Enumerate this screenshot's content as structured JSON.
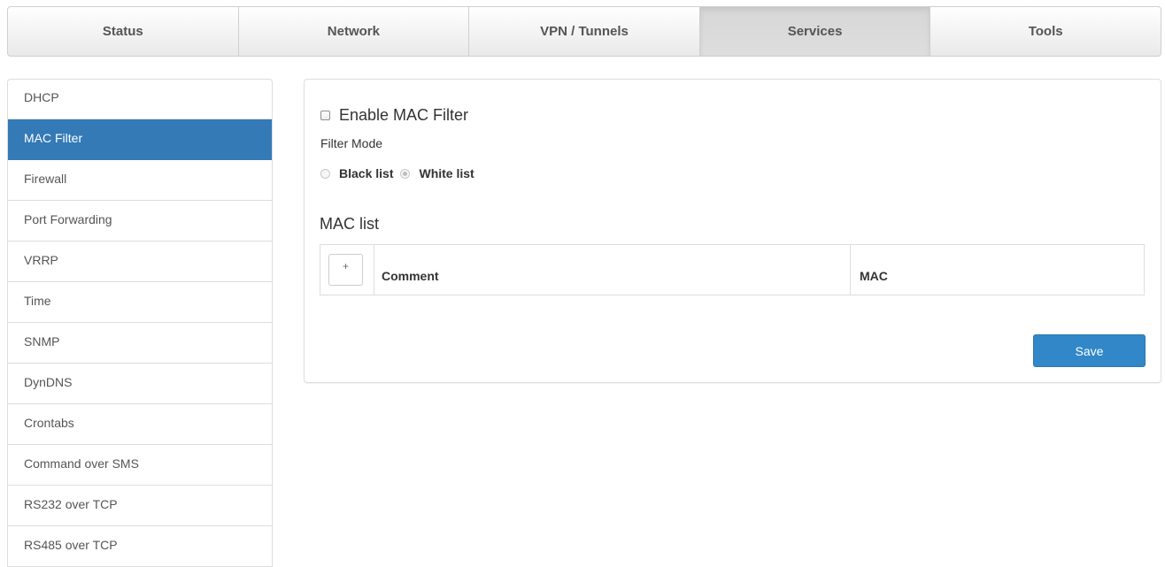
{
  "topnav": {
    "tabs": [
      {
        "label": "Status"
      },
      {
        "label": "Network"
      },
      {
        "label": "VPN / Tunnels"
      },
      {
        "label": "Services",
        "active": true
      },
      {
        "label": "Tools"
      }
    ]
  },
  "sidebar": {
    "items": [
      {
        "label": "DHCP"
      },
      {
        "label": "MAC Filter",
        "active": true
      },
      {
        "label": "Firewall"
      },
      {
        "label": "Port Forwarding"
      },
      {
        "label": "VRRP"
      },
      {
        "label": "Time"
      },
      {
        "label": "SNMP"
      },
      {
        "label": "DynDNS"
      },
      {
        "label": "Crontabs"
      },
      {
        "label": "Command over SMS"
      },
      {
        "label": "RS232 over TCP"
      },
      {
        "label": "RS485 over TCP"
      }
    ]
  },
  "main": {
    "enable_label": "Enable MAC Filter",
    "enable_checked": false,
    "filter_mode_label": "Filter Mode",
    "black_list_label": "Black list",
    "white_list_label": "White list",
    "selected_mode": "White list",
    "mac_list_title": "MAC list",
    "table": {
      "add_label": "+",
      "columns": [
        "Comment",
        "MAC"
      ]
    },
    "save_label": "Save"
  },
  "colors": {
    "accent": "#337ab7",
    "save_button": "#3187c8"
  }
}
